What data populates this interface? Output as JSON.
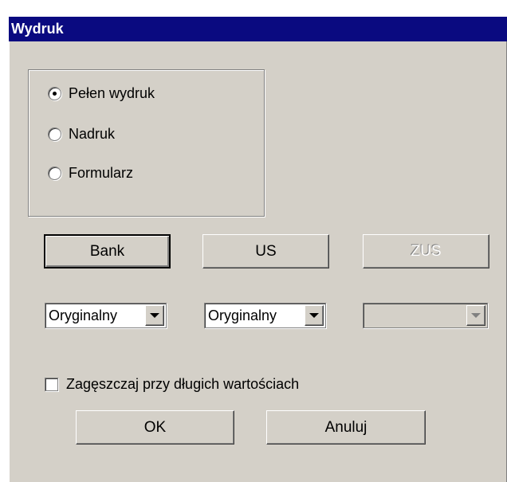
{
  "window": {
    "title": "Wydruk"
  },
  "print_mode": {
    "options": [
      {
        "label": "Pełen wydruk",
        "selected": true
      },
      {
        "label": "Nadruk",
        "selected": false
      },
      {
        "label": "Formularz",
        "selected": false
      }
    ]
  },
  "buttons": {
    "bank": "Bank",
    "us": "US",
    "zus": "ZUS"
  },
  "selects": {
    "bank": {
      "value": "Oryginalny"
    },
    "us": {
      "value": "Oryginalny"
    },
    "zus": {
      "value": ""
    }
  },
  "compress": {
    "label": "Zagęszczaj przy długich wartościach",
    "checked": false
  },
  "actions": {
    "ok": "OK",
    "cancel": "Anuluj"
  },
  "colors": {
    "titlebar": "#0a0a80",
    "face": "#d4d0c8"
  }
}
